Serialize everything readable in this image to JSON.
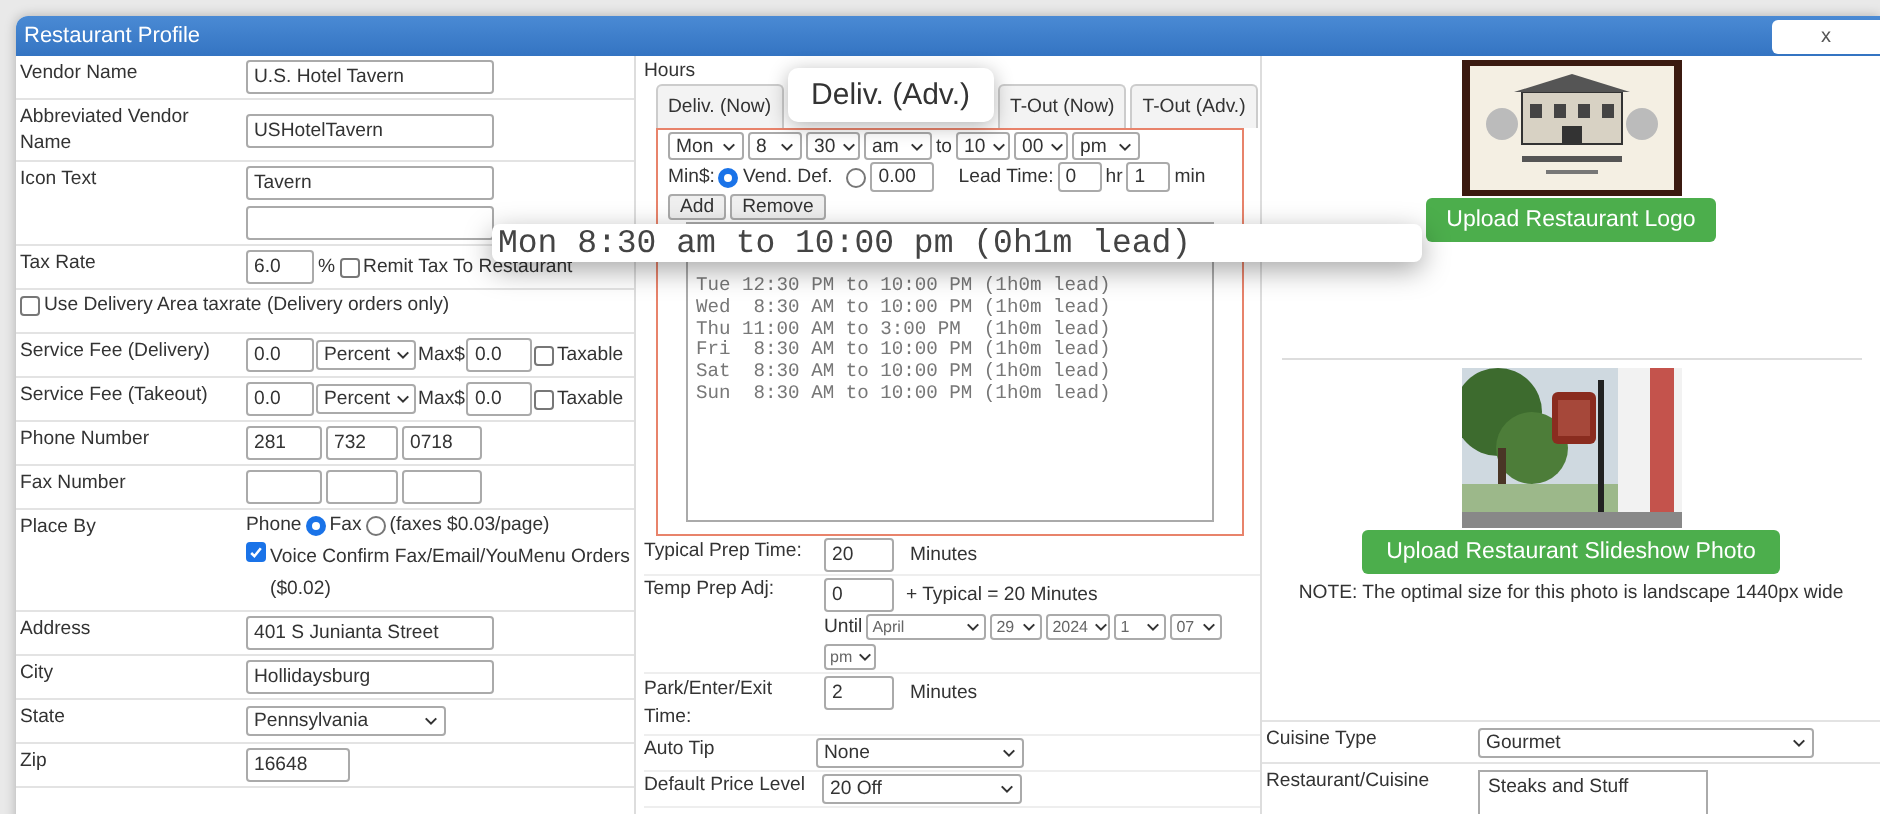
{
  "window": {
    "title": "Restaurant Profile",
    "close": "x"
  },
  "profile_fields": [
    {
      "kind": "text",
      "label": "Vendor Name",
      "value": "U.S. Hotel Tavern"
    },
    {
      "kind": "text",
      "label": "Abbreviated Vendor Name",
      "value": "USHotelTavern"
    },
    {
      "kind": "double",
      "label": "Icon Text",
      "value": "Tavern"
    },
    {
      "kind": "tax",
      "label": "Tax Rate",
      "value": "6.0",
      "unit": "%",
      "option": {
        "label": "Remit Tax To Restaurant",
        "checked": false
      }
    },
    {
      "kind": "check",
      "label": "Use Delivery Area taxrate (Delivery orders only)",
      "checked": false
    },
    {
      "kind": "fee",
      "label": "Service Fee (Delivery)",
      "value": "0.0",
      "type": "Percent",
      "max_label": "Max$",
      "max": "0.0",
      "option": {
        "label": "Taxable",
        "checked": false
      }
    },
    {
      "kind": "fee",
      "label": "Service Fee (Takeout)",
      "value": "0.0",
      "type": "Percent",
      "max_label": "Max$",
      "max": "0.0",
      "option": {
        "label": "Taxable",
        "checked": false
      }
    },
    {
      "kind": "phone",
      "label": "Phone Number",
      "area": "281",
      "prefix": "732",
      "line": "0718"
    },
    {
      "kind": "phone",
      "label": "Fax Number"
    },
    {
      "kind": "placeby",
      "label": "Place By",
      "options": [
        {
          "label": "Phone",
          "selected": true
        },
        {
          "label": "Fax",
          "selected": false
        }
      ],
      "note": "(faxes $0.03/page)",
      "option": {
        "label": "Voice Confirm Fax/Email/YouMenu Orders ($0.02)",
        "checked": true
      }
    },
    {
      "kind": "text",
      "label": "Address",
      "value": "401 S Junianta Street"
    },
    {
      "kind": "text",
      "label": "City",
      "value": "Hollidaysburg"
    },
    {
      "kind": "select",
      "label": "State",
      "value": "Pennsylvania"
    },
    {
      "kind": "short",
      "label": "Zip",
      "value": "16648"
    }
  ],
  "hours": {
    "title": "Hours",
    "tabs": [
      {
        "label": "Deliv. (Now)",
        "selected": false
      },
      {
        "label": "Deliv. (Adv.)",
        "selected": true
      },
      {
        "label": "T-Out (Now)",
        "selected": false
      },
      {
        "label": "T-Out (Adv.)",
        "selected": false
      }
    ],
    "editor": {
      "day": "Mon",
      "hour": "8",
      "minute": "30",
      "ampm": "am",
      "to_label": "to",
      "to_hour": "10",
      "to_minute": "00",
      "to_ampm": "pm",
      "min_label": "Min$:",
      "default_option": {
        "label": "Vend. Def.",
        "selected": true
      },
      "custom_option": {
        "value": "0.00",
        "selected": false
      },
      "lead_label": "Lead Time:",
      "lead_hours": "0",
      "hours_unit": "hr",
      "lead_minutes": "1",
      "minutes_unit": "min",
      "add": "Add",
      "remove": "Remove"
    },
    "schedule": [
      "Tue 12:30 PM to 10:00 PM (1h0m lead)",
      "Wed  8:30 AM to 10:00 PM (1h0m lead)",
      "Thu 11:00 AM to 3:00 PM  (1h0m lead)",
      "Fri  8:30 AM to 10:00 PM (1h0m lead)",
      "Sat  8:30 AM to 10:00 PM (1h0m lead)",
      "Sun  8:30 AM to 10:00 PM (1h0m lead)"
    ],
    "magnified_line": "Mon 8:30 am to 10:00 pm (0h1m lead)"
  },
  "prep_fields": [
    {
      "kind": "minutes",
      "label": "Typical Prep Time:",
      "value": "20",
      "unit": "Minutes"
    },
    {
      "kind": "adjust",
      "label": "Temp Prep Adj:",
      "value": "0",
      "note": "+ Typical = 20 Minutes",
      "until_label": "Until",
      "until": [
        "April",
        "29",
        "2024",
        "1",
        "07",
        "pm"
      ]
    },
    {
      "kind": "minutes",
      "label": "Park/Enter/Exit Time:",
      "value": "2",
      "unit": "Minutes"
    },
    {
      "kind": "select",
      "label": "Auto Tip",
      "value": "None"
    },
    {
      "kind": "select",
      "label": "Default Price Level",
      "value": "20 Off"
    }
  ],
  "media": {
    "logo_button": "Upload Restaurant Logo",
    "photo_button": "Upload Restaurant Slideshow Photo",
    "note": "NOTE: The optimal size for this photo is landscape 1440px wide"
  },
  "cuisine_fields": [
    {
      "kind": "select",
      "label": "Cuisine Type",
      "value": "Gourmet"
    },
    {
      "kind": "area",
      "label": "Restaurant/Cuisine",
      "value": "Steaks and Stuff"
    }
  ]
}
